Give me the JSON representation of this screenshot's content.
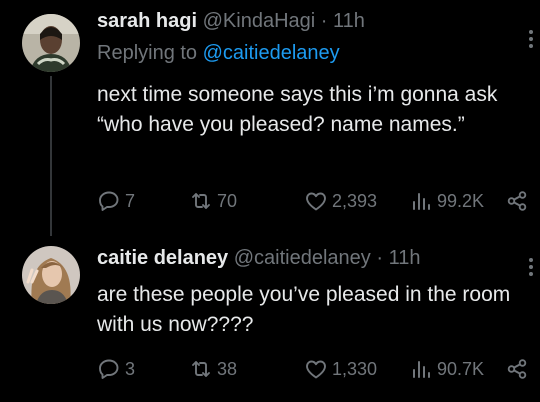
{
  "tweets": [
    {
      "name": "sarah hagi",
      "handle": "@KindaHagi",
      "separator": "·",
      "time": "11h",
      "replying_prefix": "Replying to",
      "replying_to": "@caitiedelaney",
      "text": "next time someone says this i’m gonna ask “who have you pleased? name names.”",
      "replies": "7",
      "retweets": "70",
      "likes": "2,393",
      "views": "99.2K"
    },
    {
      "name": "caitie delaney",
      "handle": "@caitiedelaney",
      "separator": "·",
      "time": "11h",
      "text": "are these people you’ve pleased in the room with us now????",
      "replies": "3",
      "retweets": "38",
      "likes": "1,330",
      "views": "90.7K"
    }
  ],
  "colors": {
    "background": "#000000",
    "text": "#e7e9ea",
    "muted": "#71767b",
    "link": "#1d9bf0",
    "thread_line": "#333639"
  },
  "icons": [
    "reply-icon",
    "retweet-icon",
    "like-icon",
    "views-icon",
    "share-icon",
    "more-icon"
  ]
}
